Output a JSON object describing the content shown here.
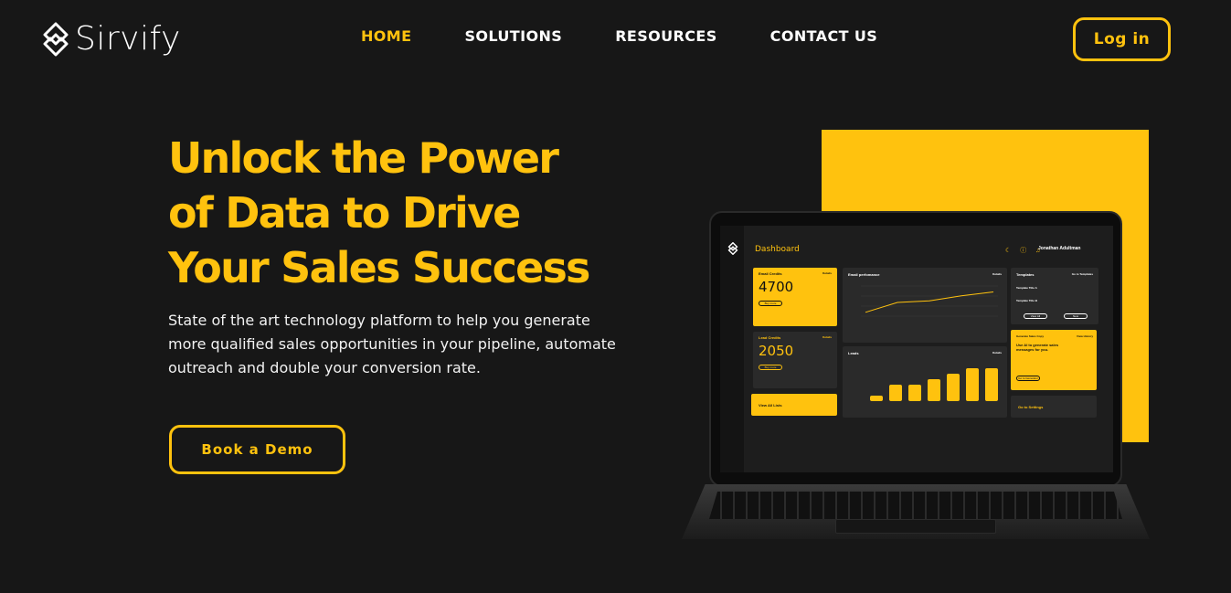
{
  "brand": {
    "name": "Sirvify"
  },
  "nav": {
    "items": [
      "HOME",
      "SOLUTIONS",
      "RESOURCES",
      "CONTACT US"
    ],
    "active": "HOME"
  },
  "header": {
    "login_label": "Log in"
  },
  "hero": {
    "title_lines": [
      "Unlock the Power",
      "of Data to Drive",
      "Your Sales Success"
    ],
    "subtitle_lines": [
      "State of the art technology platform to help you generate",
      "more qualified sales opportunities in your pipeline, automate",
      "outreach and double your conversion rate."
    ],
    "cta_label": "Book a Demo"
  },
  "colors": {
    "accent": "#ffc20e",
    "background": "#171717"
  },
  "dashboard": {
    "title": "Dashboard",
    "user": "Jonathan Adultman",
    "email_credits": {
      "label": "Email Credits",
      "value": "4700",
      "details": "Details",
      "button": "Buy more"
    },
    "lead_credits": {
      "label": "Lead Credits",
      "value": "2050",
      "details": "Details",
      "button": "Buy more"
    },
    "view_all_lists": "View All Lists",
    "email_performance": {
      "title": "Email perfomance",
      "details": "Details",
      "values": [
        20,
        50,
        55,
        70,
        82
      ]
    },
    "leads": {
      "title": "Leads",
      "details": "Details",
      "values": [
        1,
        3,
        3,
        4,
        5,
        6,
        6
      ]
    },
    "templates": {
      "title": "Templates",
      "go": "Go to Templates",
      "items": [
        "Template Title A",
        "Template Title B"
      ],
      "view_all": "View All",
      "new": "New"
    },
    "generate": {
      "title": "Generate Sales Copy",
      "link": "View History",
      "text": "Use AI to generate sales messages for you.",
      "button": "Go to Generator"
    },
    "settings": "Go to Settings"
  }
}
